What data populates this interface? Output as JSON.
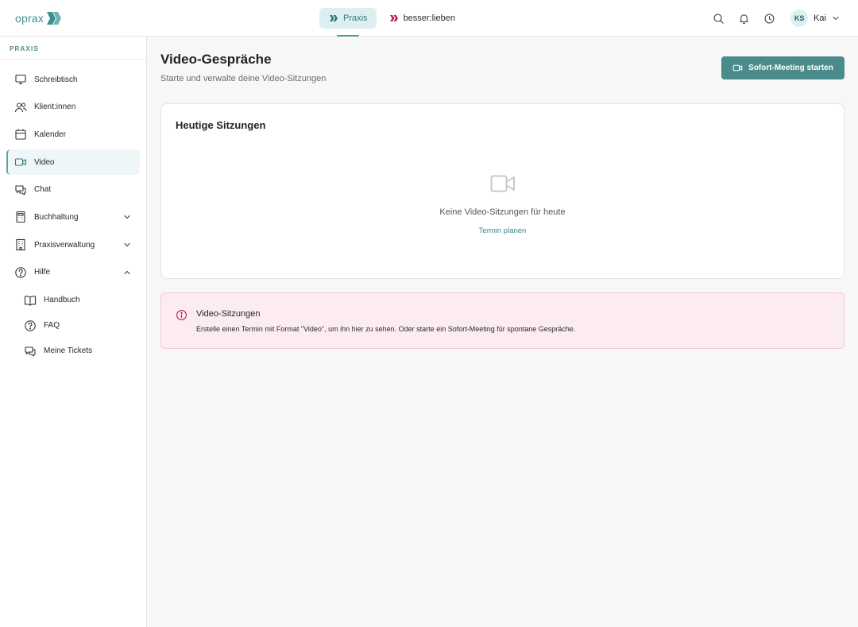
{
  "header": {
    "logo_text": "oprax",
    "tabs": [
      {
        "label": "Praxis",
        "active": true,
        "icon": "chevrons-teal-icon"
      },
      {
        "label": "besser:lieben",
        "active": false,
        "icon": "chevrons-crimson-icon"
      }
    ],
    "icons": [
      "search-icon",
      "bell-icon",
      "clock-icon"
    ],
    "user": {
      "initials": "KS",
      "name": "Kai"
    }
  },
  "sidebar": {
    "section": "PRAXIS",
    "items": [
      {
        "label": "Schreibtisch",
        "icon": "monitor-icon"
      },
      {
        "label": "Klient:innen",
        "icon": "users-icon"
      },
      {
        "label": "Kalender",
        "icon": "calendar-icon"
      },
      {
        "label": "Video",
        "icon": "video-icon",
        "active": true
      },
      {
        "label": "Chat",
        "icon": "chat-icon"
      },
      {
        "label": "Buchhaltung",
        "icon": "calculator-icon",
        "expandable": "collapsed"
      },
      {
        "label": "Praxisverwaltung",
        "icon": "building-icon",
        "expandable": "collapsed"
      },
      {
        "label": "Hilfe",
        "icon": "help-icon",
        "expandable": "expanded"
      }
    ],
    "subitems": [
      {
        "label": "Handbuch",
        "icon": "book-icon"
      },
      {
        "label": "FAQ",
        "icon": "help-icon"
      },
      {
        "label": "Meine Tickets",
        "icon": "chat-icon"
      }
    ]
  },
  "main": {
    "title": "Video-Gespräche",
    "subtitle": "Starte und verwalte deine Video-Sitzungen",
    "primary_button": "Sofort-Meeting starten",
    "card": {
      "title": "Heutige Sitzungen",
      "empty_text": "Keine Video-Sitzungen für heute",
      "empty_link": "Termin planen"
    },
    "info": {
      "title": "Video-Sitzungen",
      "text": "Erstelle einen Termin mit Format \"Video\", um ihn hier zu sehen. Oder starte ein Sofort-Meeting für spontane Gespräche."
    }
  },
  "colors": {
    "brand": "#4a8c8b",
    "accent_secondary": "#c2185b",
    "info_background": "#fcecf0",
    "info_icon": "#b02553"
  }
}
